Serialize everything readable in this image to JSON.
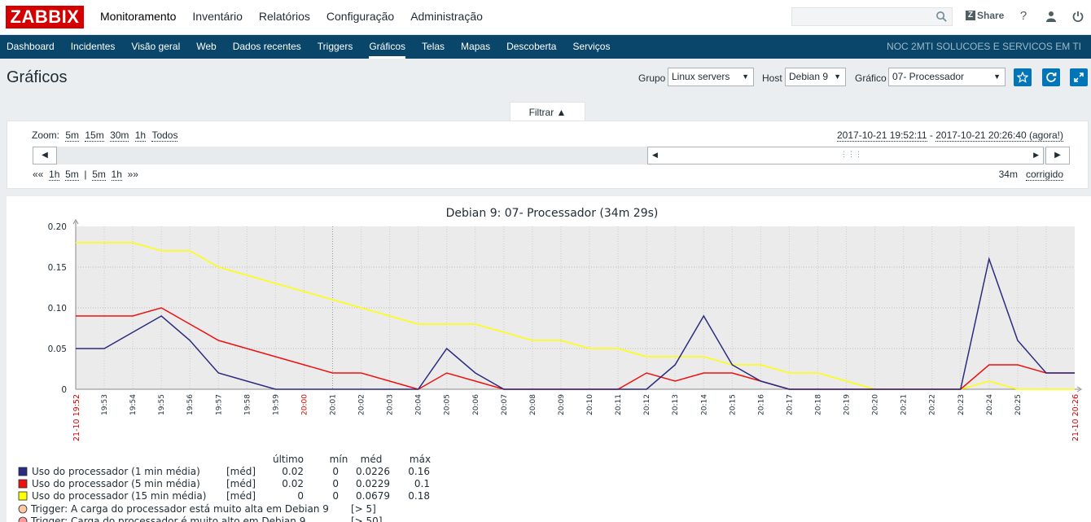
{
  "app": {
    "logo": "ZABBIX",
    "top_menu": [
      "Monitoramento",
      "Inventário",
      "Relatórios",
      "Configuração",
      "Administração"
    ],
    "share_label": "Share",
    "search_placeholder": ""
  },
  "sub_menu": {
    "items": [
      "Dashboard",
      "Incidentes",
      "Visão geral",
      "Web",
      "Dados recentes",
      "Triggers",
      "Gráficos",
      "Telas",
      "Mapas",
      "Descoberta",
      "Serviços"
    ],
    "active": "Gráficos",
    "org": "NOC 2MTI SOLUCOES E SERVICOS EM TI"
  },
  "page": {
    "title": "Gráficos",
    "group_label": "Grupo",
    "group_value": "Linux servers",
    "host_label": "Host",
    "host_value": "Debian 9",
    "graph_label": "Gráfico",
    "graph_value": "07- Processador"
  },
  "filter": {
    "tab_label": "Filtrar ▲",
    "zoom_label": "Zoom:",
    "zoom_options": [
      "5m",
      "15m",
      "30m",
      "1h",
      "Todos"
    ],
    "period_from": "2017-10-21 19:52:11",
    "period_sep": " - ",
    "period_to": "2017-10-21 20:26:40 (agora!)",
    "nav_back_arrows": "«« ",
    "nav_back": [
      "1h",
      "5m"
    ],
    "nav_sep": "|",
    "nav_fwd": [
      "5m",
      "1h"
    ],
    "nav_fwd_arrows": " »»",
    "duration": "34m",
    "fixed_label": "corrigido"
  },
  "chart_data": {
    "type": "line",
    "title": "Debian 9: 07- Processador (34m 29s)",
    "x": [
      "19:52",
      "19:53",
      "19:54",
      "19:55",
      "19:56",
      "19:57",
      "19:58",
      "19:59",
      "20:00",
      "20:01",
      "20:02",
      "20:03",
      "20:04",
      "20:05",
      "20:06",
      "20:07",
      "20:08",
      "20:09",
      "20:10",
      "20:11",
      "20:12",
      "20:13",
      "20:14",
      "20:15",
      "20:16",
      "20:17",
      "20:18",
      "20:19",
      "20:20",
      "20:21",
      "20:22",
      "20:23",
      "20:24",
      "20:25",
      "20:26"
    ],
    "x_start_label": "21-10 19:52",
    "x_end_label": "21-10 20:26",
    "highlight_ticks": [
      "20:00"
    ],
    "yticks": [
      "0.20",
      "0.15",
      "0.10",
      "0.05",
      "0"
    ],
    "ylim": [
      0,
      0.2
    ],
    "grid": true,
    "series": [
      {
        "name": "Uso do processador (1 min média)",
        "color": "#2b2b7f",
        "values": [
          0.05,
          0.05,
          0.07,
          0.09,
          0.06,
          0.02,
          0.01,
          0,
          0,
          0,
          0,
          0,
          0,
          0.05,
          0.02,
          0,
          0,
          0,
          0,
          0,
          0,
          0.03,
          0.09,
          0.03,
          0.01,
          0,
          0,
          0,
          0,
          0,
          0,
          0,
          0.16,
          0.06,
          0.02,
          0.02
        ]
      },
      {
        "name": "Uso do processador (5 min média)",
        "color": "#ee1111",
        "values": [
          0.09,
          0.09,
          0.09,
          0.1,
          0.08,
          0.06,
          0.05,
          0.04,
          0.03,
          0.02,
          0.02,
          0.01,
          0,
          0.02,
          0.01,
          0,
          0,
          0,
          0,
          0,
          0.02,
          0.01,
          0.02,
          0.02,
          0.01,
          0,
          0,
          0,
          0,
          0,
          0,
          0,
          0.03,
          0.03,
          0.02,
          0.02
        ]
      },
      {
        "name": "Uso do processador (15 min média)",
        "color": "#ffff00",
        "values": [
          0.18,
          0.18,
          0.18,
          0.17,
          0.17,
          0.15,
          0.14,
          0.13,
          0.12,
          0.11,
          0.1,
          0.09,
          0.08,
          0.08,
          0.08,
          0.07,
          0.06,
          0.06,
          0.05,
          0.05,
          0.04,
          0.04,
          0.04,
          0.03,
          0.03,
          0.02,
          0.02,
          0.01,
          0,
          0,
          0,
          0,
          0.01,
          0,
          0,
          0
        ]
      }
    ],
    "legend": {
      "headers": [
        "último",
        "mín",
        "méd",
        "máx"
      ],
      "rows": [
        {
          "name": "Uso do processador (1 min média)",
          "tag": "[méd]",
          "last": "0.02",
          "min": "0",
          "avg": "0.0226",
          "max": "0.16",
          "color": "#2b2b7f"
        },
        {
          "name": "Uso do processador (5 min média)",
          "tag": "[méd]",
          "last": "0.02",
          "min": "0",
          "avg": "0.0229",
          "max": "0.1",
          "color": "#ee1111"
        },
        {
          "name": "Uso do processador (15 min média)",
          "tag": "[méd]",
          "last": "0",
          "min": "0",
          "avg": "0.0679",
          "max": "0.18",
          "color": "#ffff00"
        }
      ],
      "triggers": [
        {
          "text": "Trigger: A carga do processador está muito alta em Debian 9",
          "cond": "[> 5]",
          "color": "#ffc8a0"
        },
        {
          "text": "Trigger: Carga do processador é muito alto em Debian 9",
          "cond": "[> 50]",
          "color": "#ff9a9a"
        }
      ]
    }
  }
}
